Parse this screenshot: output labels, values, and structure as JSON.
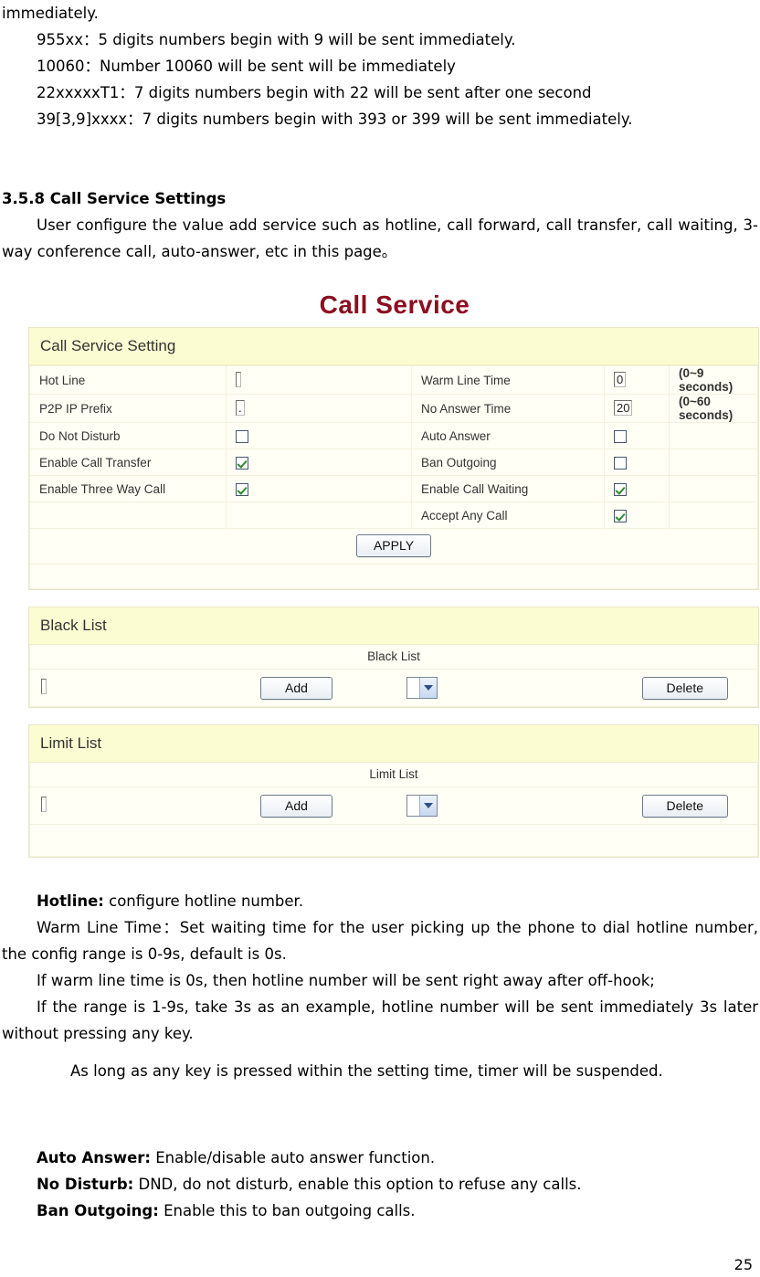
{
  "document": {
    "top_paragraphs": [
      "immediately.",
      "955xx：5 digits numbers begin with 9 will be sent immediately.",
      "10060：Number 10060 will be sent will be immediately",
      "22xxxxxT1：7 digits numbers begin with 22 will be sent after one second",
      "39[3,9]xxxx：7 digits numbers begin with 393 or 399 will be sent immediately."
    ],
    "section_heading": "3.5.8 Call Service Settings",
    "section_intro": "User configure the value add service such as hotline, call forward, call transfer, call waiting, 3-way conference call, auto-answer, etc in this page。",
    "after_figure": {
      "hotline_label": "Hotline:",
      "hotline_text": " configure hotline number.",
      "warm_line_time": "Warm Line Time：Set waiting time for the user picking up the phone to dial hotline number, the config range is 0-9s, default is 0s.",
      "warm_zero": "If warm line time is 0s, then hotline number will be sent right away after off-hook;",
      "warm_range": "If the range is 1-9s, take 3s as an example, hotline number will be sent immediately 3s later without pressing any key.",
      "key_press": "As long as any key is pressed within the setting time, timer will be suspended.",
      "auto_answer_label": "Auto Answer:",
      "auto_answer_text": " Enable/disable auto answer function.",
      "no_disturb_label": "No Disturb:",
      "no_disturb_text": " DND, do not disturb, enable this option to refuse any calls.",
      "ban_outgoing_label": "Ban Outgoing:",
      "ban_outgoing_text": " Enable this to ban outgoing calls."
    },
    "page_number": "25"
  },
  "figure": {
    "title": "Call Service",
    "title_color": "#8B0F20",
    "panel_header_bg": "#FCFCD2",
    "settings": {
      "header": "Call Service Setting",
      "rows": [
        {
          "left_label": "Hot Line",
          "left_type": "text",
          "left_value": "",
          "right_label": "Warm Line Time",
          "right_type": "text",
          "right_value": "0",
          "hint": "(0~9 seconds)"
        },
        {
          "left_label": "P2P IP Prefix",
          "left_type": "text",
          "left_value": ".",
          "right_label": "No Answer Time",
          "right_type": "text",
          "right_value": "20",
          "hint": "(0~60 seconds)"
        },
        {
          "left_label": "Do Not Disturb",
          "left_type": "checkbox",
          "left_checked": false,
          "right_label": "Auto Answer",
          "right_type": "checkbox",
          "right_checked": false,
          "hint": ""
        },
        {
          "left_label": "Enable Call Transfer",
          "left_type": "checkbox",
          "left_checked": true,
          "right_label": "Ban Outgoing",
          "right_type": "checkbox",
          "right_checked": false,
          "hint": ""
        },
        {
          "left_label": "Enable Three Way Call",
          "left_type": "checkbox",
          "left_checked": true,
          "right_label": "Enable Call Waiting",
          "right_type": "checkbox",
          "right_checked": true,
          "hint": ""
        },
        {
          "left_label": "",
          "left_type": "none",
          "right_label": "Accept Any Call",
          "right_type": "checkbox",
          "right_checked": true,
          "hint": ""
        }
      ],
      "apply_label": "APPLY"
    },
    "black_list": {
      "header": "Black List",
      "column_label": "Black List",
      "input_value": "",
      "add_label": "Add",
      "delete_label": "Delete",
      "select_value": ""
    },
    "limit_list": {
      "header": "Limit List",
      "column_label": "Limit List",
      "input_value": "",
      "add_label": "Add",
      "delete_label": "Delete",
      "select_value": ""
    }
  }
}
